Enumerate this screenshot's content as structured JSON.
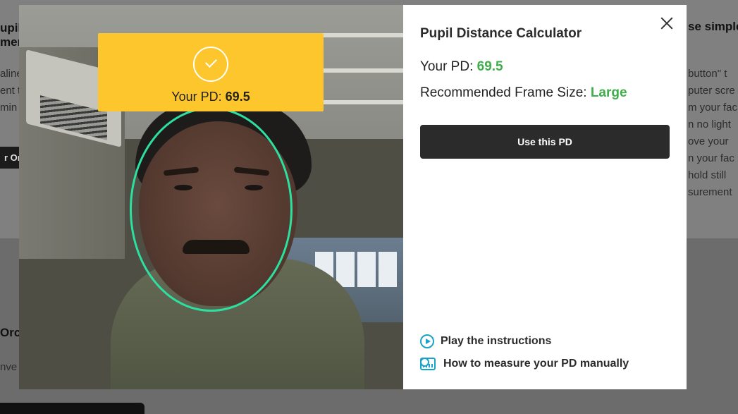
{
  "background_page": {
    "fragments": [
      "upill",
      "men",
      "aline",
      "ent t",
      "min",
      "r On",
      "Orc",
      "nve",
      "se simple",
      "button\" t",
      "puter scre",
      "m your fac",
      "n no light",
      "ove your",
      "n your fac",
      "hold still",
      "surement"
    ]
  },
  "modal": {
    "title": "Pupil Distance Calculator",
    "badge": {
      "label": "Your PD:",
      "value": "69.5"
    },
    "pd_row": {
      "label": "Your PD:",
      "value": "69.5"
    },
    "frame_row": {
      "label": "Recommended Frame Size:",
      "value": "Large"
    },
    "use_button": "Use this PD",
    "links": {
      "play": "Play the instructions",
      "manual": "How to measure your PD manually"
    },
    "icons": {
      "close": "close-icon",
      "check": "check-icon",
      "play": "play-icon",
      "ruler": "ruler-icon"
    },
    "colors": {
      "accent_green": "#3fae4b",
      "badge_yellow": "#fdc62c",
      "oval_green": "#2de0a0",
      "link_blue": "#1aa3c8",
      "button_dark": "#2b2b2b"
    }
  }
}
